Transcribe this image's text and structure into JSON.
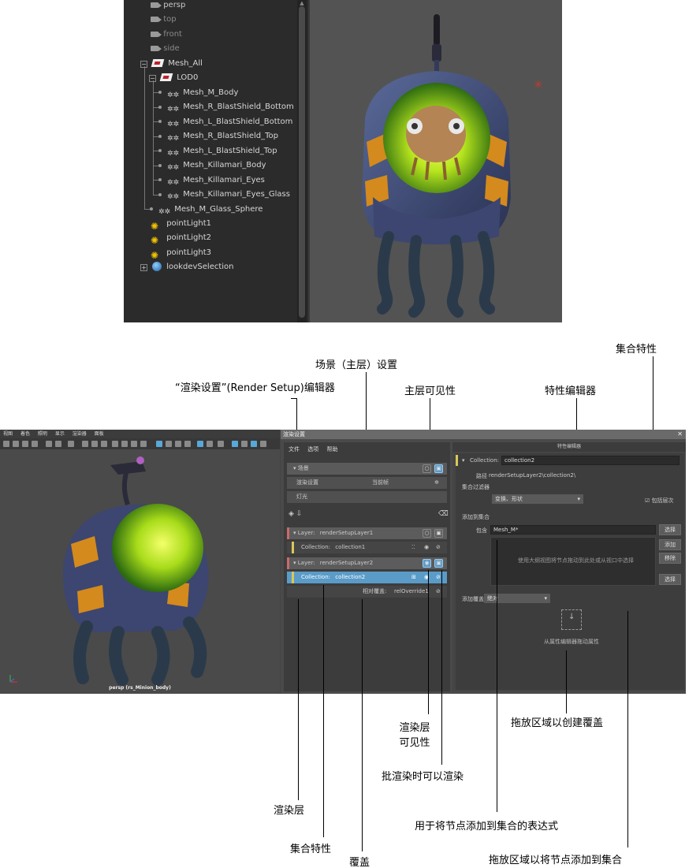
{
  "outliner": {
    "items": [
      {
        "label": "persp",
        "kind": "camera",
        "dim": false
      },
      {
        "label": "top",
        "kind": "camera",
        "dim": true
      },
      {
        "label": "front",
        "kind": "camera",
        "dim": true
      },
      {
        "label": "side",
        "kind": "camera",
        "dim": true
      },
      {
        "label": "Mesh_All",
        "kind": "group"
      },
      {
        "label": "LOD0",
        "kind": "group"
      },
      {
        "label": "Mesh_M_Body",
        "kind": "mesh"
      },
      {
        "label": "Mesh_R_BlastShield_Bottom",
        "kind": "mesh"
      },
      {
        "label": "Mesh_L_BlastShield_Bottom",
        "kind": "mesh"
      },
      {
        "label": "Mesh_R_BlastShield_Top",
        "kind": "mesh"
      },
      {
        "label": "Mesh_L_BlastShield_Top",
        "kind": "mesh"
      },
      {
        "label": "Mesh_Killamari_Body",
        "kind": "mesh"
      },
      {
        "label": "Mesh_Killamari_Eyes",
        "kind": "mesh"
      },
      {
        "label": "Mesh_Killamari_Eyes_Glass",
        "kind": "mesh"
      },
      {
        "label": "Mesh_M_Glass_Sphere",
        "kind": "mesh"
      },
      {
        "label": "pointLight1",
        "kind": "light"
      },
      {
        "label": "pointLight2",
        "kind": "light"
      },
      {
        "label": "pointLight3",
        "kind": "light"
      },
      {
        "label": "lookdevSelection",
        "kind": "set"
      }
    ]
  },
  "viewport": {
    "menu": [
      "视图",
      "着色",
      "照明",
      "显示",
      "渲染器",
      "面板"
    ],
    "caption": "persp (rs_Minion_body)"
  },
  "render_setup": {
    "window_title": "渲染设置",
    "menu": [
      "文件",
      "选项",
      "帮助"
    ],
    "scene_label": "场景",
    "render_settings_label": "渲染设置",
    "current_frame_label": "当前帧",
    "lights_label": "灯光",
    "layer1": {
      "prefix": "Layer:",
      "name": "renderSetupLayer1"
    },
    "collection1": {
      "prefix": "Collection:",
      "name": "collection1"
    },
    "layer2": {
      "prefix": "Layer:",
      "name": "renderSetupLayer2"
    },
    "collection2": {
      "prefix": "Collection:",
      "name": "collection2"
    },
    "override": {
      "prefix": "相对覆盖:",
      "name": "relOverride1"
    }
  },
  "attribute_editor": {
    "title": "特性编辑器",
    "collection_prefix": "Collection:",
    "collection_name": "collection2",
    "path_label": "路径",
    "path_value": "renderSetupLayer2\\collection2\\",
    "filter_label": "集合过滤器",
    "filter_value": "变换、形状",
    "include_hierarchy_label": "包括层次",
    "add_to_collection_label": "添加到集合",
    "include_label": "包含",
    "include_value": "Mesh_M*",
    "select_btn": "选择",
    "add_btn": "添加",
    "remove_btn": "移除",
    "select_btn2": "选择",
    "drop_hint": "使用大纲视图将节点拖动到此处或从视口中选择",
    "add_override_label": "添加覆盖",
    "override_mode": "绝对",
    "drag_attr_hint": "从属性编辑器拖动属性"
  },
  "callouts": {
    "collection_attributes_top": "集合特性",
    "scene_settings": "场景（主层）设置",
    "rs_editor": "“渲染设置”(Render Setup)编辑器",
    "master_visibility": "主层可见性",
    "property_editor": "特性编辑器",
    "layer_visibility_1": "渲染层",
    "layer_visibility_2": "可见性",
    "batch_renderable": "批渲染时可以渲染",
    "drop_override": "拖放区域以创建覆盖",
    "render_layer": "渲染层",
    "expression": "用于将节点添加到集合的表达式",
    "collection_attributes_bottom": "集合特性",
    "override": "覆盖",
    "drop_nodes": "拖放区域以将节点添加到集合"
  },
  "colors": {
    "layer_stripe": "#c96a6a",
    "collection_stripe": "#d8c85a",
    "selected": "#5a9bc8",
    "light_icon": "#f2c200",
    "viewport_bg": "#535353"
  }
}
